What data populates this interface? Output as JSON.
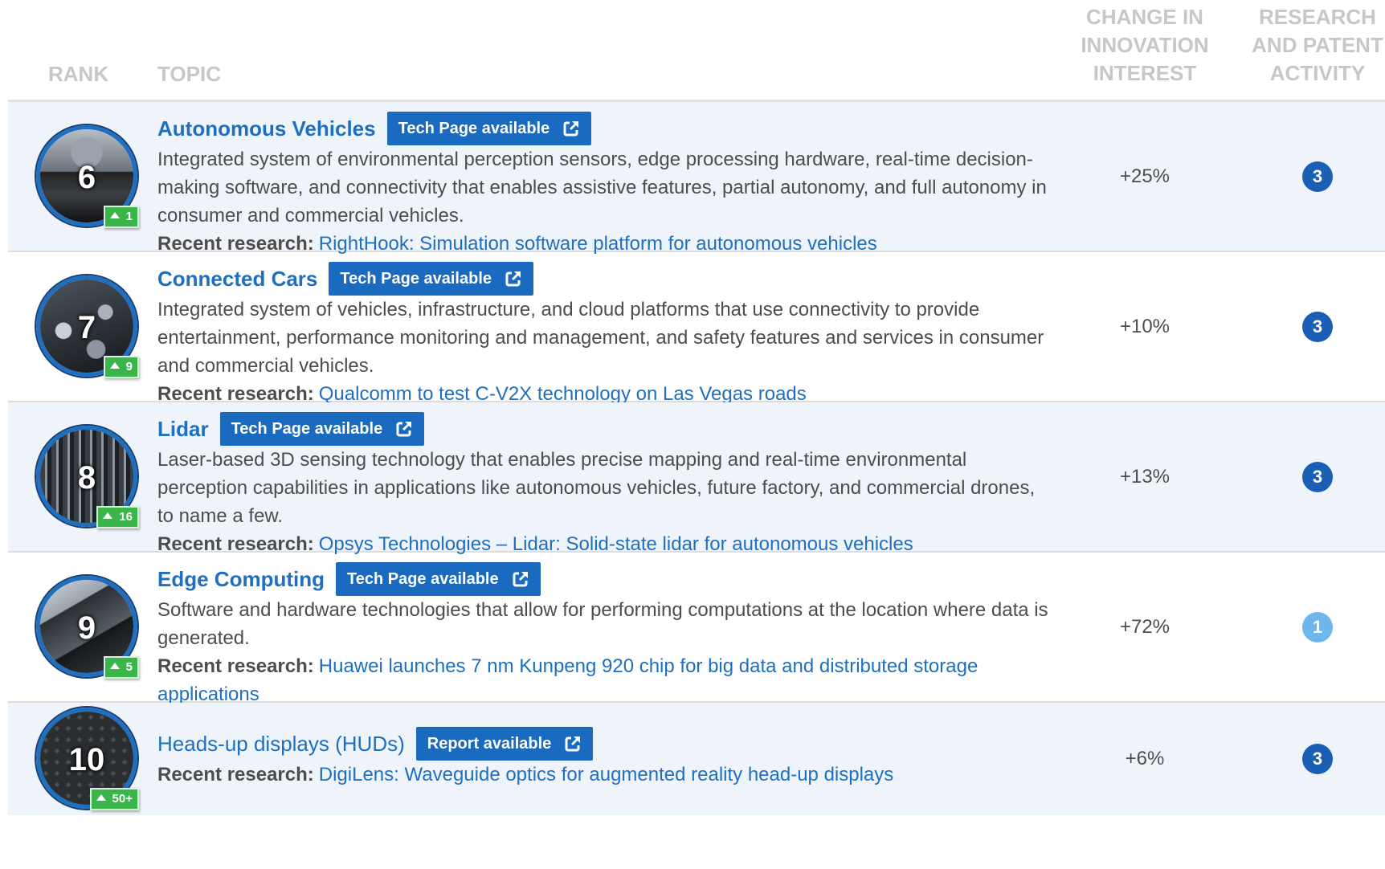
{
  "header": {
    "rank": "Rank",
    "topic": "Topic",
    "change_l1": "Change in",
    "change_l2": "innovation",
    "change_l3": "interest",
    "research_l1": "Research",
    "research_l2": "and patent",
    "research_l3": "activity"
  },
  "colors": {
    "accent_blue": "#1f6fc0",
    "button_blue": "#1a6ac0",
    "up_green": "#39b54a",
    "research_dark": "#1a5fb4",
    "research_light": "#6fb6ec",
    "row_alt": "#eff4fb"
  },
  "rows": [
    {
      "rank": "6",
      "movement": "1",
      "title": "Autonomous Vehicles",
      "button": "Tech Page available",
      "description": "Integrated system of environmental perception sensors, edge processing hardware, real-time decision-making software, and connectivity that enables assistive features, partial autonomy, and full autonomy in consumer and commercial vehicles.",
      "recent_label": "Recent research:",
      "recent_link": "RightHook: Simulation software platform for autonomous vehicles",
      "change": "+25%",
      "research": "3"
    },
    {
      "rank": "7",
      "movement": "9",
      "title": "Connected Cars",
      "button": "Tech Page available",
      "description": "Integrated system of vehicles, infrastructure, and cloud platforms that use connectivity to provide entertainment, performance monitoring and management, and safety features and services in consumer and commercial vehicles.",
      "recent_label": "Recent research:",
      "recent_link": "Qualcomm to test C-V2X technology on Las Vegas roads",
      "change": "+10%",
      "research": "3"
    },
    {
      "rank": "8",
      "movement": "16",
      "title": "Lidar",
      "button": "Tech Page available",
      "description": "Laser-based 3D sensing technology that enables precise mapping and real-time environmental perception capabilities in applications like autonomous vehicles, future factory, and commercial drones, to name a few.",
      "recent_label": "Recent research:",
      "recent_link": "Opsys Technologies – Lidar: Solid-state lidar for autonomous vehicles",
      "change": "+13%",
      "research": "3"
    },
    {
      "rank": "9",
      "movement": "5",
      "title": "Edge Computing",
      "button": "Tech Page available",
      "description": "Software and hardware technologies that allow for performing computations at the location where data is generated.",
      "recent_label": "Recent research:",
      "recent_link": "Huawei launches 7 nm Kunpeng 920 chip for big data and distributed storage applications",
      "change": "+72%",
      "research": "1"
    },
    {
      "rank": "10",
      "movement": "50+",
      "title": "Heads-up displays (HUDs)",
      "button": "Report available",
      "description": "",
      "recent_label": "Recent research:",
      "recent_link": "DigiLens: Waveguide optics for augmented reality head-up displays",
      "change": "+6%",
      "research": "3"
    }
  ]
}
